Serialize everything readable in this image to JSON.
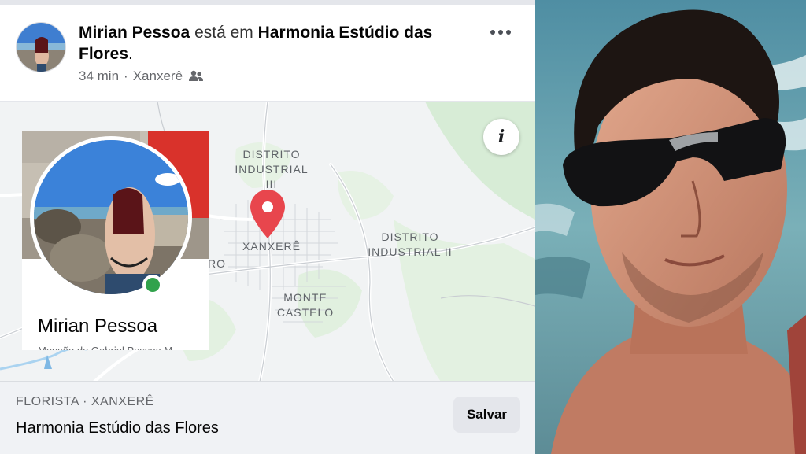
{
  "post": {
    "author": "Mirian Pessoa",
    "connector": "está em",
    "place": "Harmonia Estúdio das Flores",
    "period": ".",
    "time": "34 min",
    "separator": "·",
    "location": "Xanxerê",
    "audience_icon": "group-icon",
    "more_icon": "more-options-icon"
  },
  "map": {
    "labels": {
      "distrito_industrial_iii_line1": "DISTRITO",
      "distrito_industrial_iii_line2": "INDUSTRIAL III",
      "xanxere": "XANXERÊ",
      "distrito_industrial_ii_line1": "DISTRITO",
      "distrito_industrial_ii_line2": "INDUSTRIAL II",
      "monte_castelo_line1": "MONTE",
      "monte_castelo_line2": "CASTELO",
      "fragment_ro": "RO"
    },
    "info_icon": "i",
    "pin_color": "#e8464d"
  },
  "profile_card": {
    "name": "Mirian Pessoa",
    "subtitle": "Mensão de Gabriel Pessoa M..."
  },
  "footer": {
    "category": "FLORISTA · XANXERÊ",
    "place_name": "Harmonia Estúdio das Flores",
    "save_label": "Salvar"
  },
  "colors": {
    "online": "#31a24c",
    "map_bg": "#f1f3f4",
    "footer_bg": "#f0f2f5",
    "button_bg": "#e4e6eb",
    "pin": "#e8464d"
  }
}
